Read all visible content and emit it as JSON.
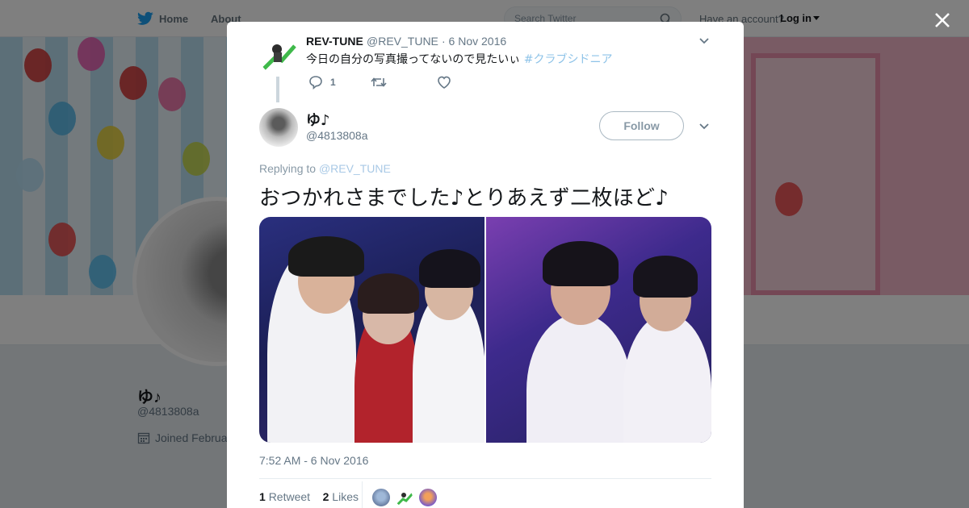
{
  "topbar": {
    "home_label": "Home",
    "about_label": "About",
    "search_placeholder": "Search Twitter",
    "have_account": "Have an account?",
    "login_label": "Log in"
  },
  "background_profile": {
    "name": "ゆ♪",
    "handle": "@4813808a",
    "joined": "Joined Februa"
  },
  "parent_tweet": {
    "name": "REV-TUNE",
    "handle": "@REV_TUNE",
    "date": "· 6 Nov 2016",
    "text": "今日の自分の写真撮ってないので見たいぃ",
    "hashtag": "#クラブシドニア",
    "reply_count": "1"
  },
  "main_tweet": {
    "name": "ゆ♪",
    "handle": "@4813808a",
    "follow_label": "Follow",
    "replying_prefix": "Replying to",
    "replying_handle": "@REV_TUNE",
    "text": "おつかれさまでした♪とりあえず二枚ほど♪",
    "timestamp": "7:52 AM - 6 Nov 2016",
    "retweet_count": "1",
    "retweet_label": "Retweet",
    "likes_count": "2",
    "likes_label": "Likes"
  },
  "colors": {
    "twitter_blue": "#1da1f2",
    "hashtag": "#8ec3e8",
    "secondary_text": "#657786"
  }
}
